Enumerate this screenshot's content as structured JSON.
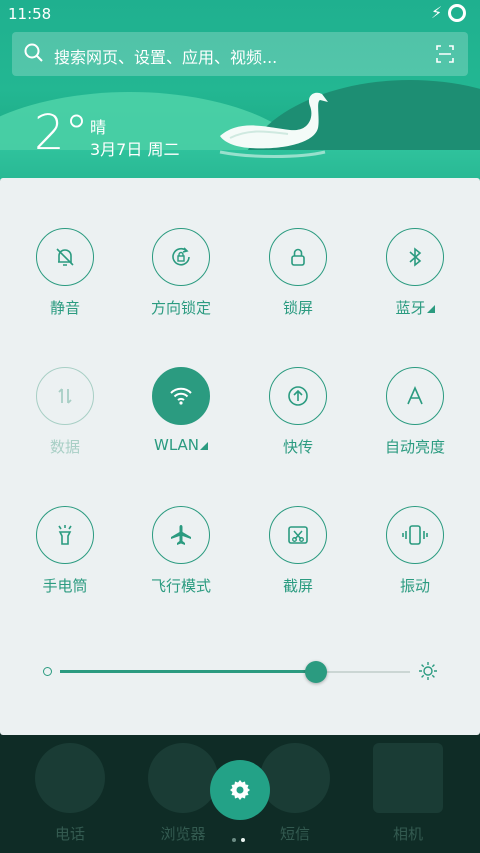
{
  "status_bar": {
    "time": "11:58"
  },
  "search": {
    "placeholder": "搜索网页、设置、应用、视频..."
  },
  "weather": {
    "temperature": "2°",
    "condition": "晴",
    "date": "3月7日 周二"
  },
  "quick_settings": {
    "tiles": [
      {
        "label": "静音",
        "icon": "bell-off-icon",
        "state": "off"
      },
      {
        "label": "方向锁定",
        "icon": "rotation-lock-icon",
        "state": "off"
      },
      {
        "label": "锁屏",
        "icon": "padlock-icon",
        "state": "off"
      },
      {
        "label": "蓝牙",
        "icon": "bluetooth-icon",
        "state": "off",
        "has_menu": true
      },
      {
        "label": "数据",
        "icon": "data-arrows-icon",
        "state": "disabled"
      },
      {
        "label": "WLAN",
        "icon": "wifi-icon",
        "state": "on",
        "has_menu": true
      },
      {
        "label": "快传",
        "icon": "quick-send-icon",
        "state": "off"
      },
      {
        "label": "自动亮度",
        "icon": "auto-brightness-icon",
        "state": "off"
      },
      {
        "label": "手电筒",
        "icon": "flashlight-icon",
        "state": "off"
      },
      {
        "label": "飞行模式",
        "icon": "airplane-icon",
        "state": "off"
      },
      {
        "label": "截屏",
        "icon": "screenshot-icon",
        "state": "off"
      },
      {
        "label": "振动",
        "icon": "vibrate-icon",
        "state": "off"
      }
    ],
    "brightness_level": 0.73
  },
  "dock": {
    "apps": [
      {
        "label": "电话",
        "icon": "phone-icon"
      },
      {
        "label": "浏览器",
        "icon": "browser-icon"
      },
      {
        "label": "短信",
        "icon": "messages-icon"
      },
      {
        "label": "相机",
        "icon": "camera-icon"
      }
    ],
    "page_indicator": {
      "count": 2,
      "active": 2
    }
  },
  "colors": {
    "accent": "#2b9b80",
    "panel": "#ecf1f2",
    "disabled": "#a8cfc5"
  }
}
